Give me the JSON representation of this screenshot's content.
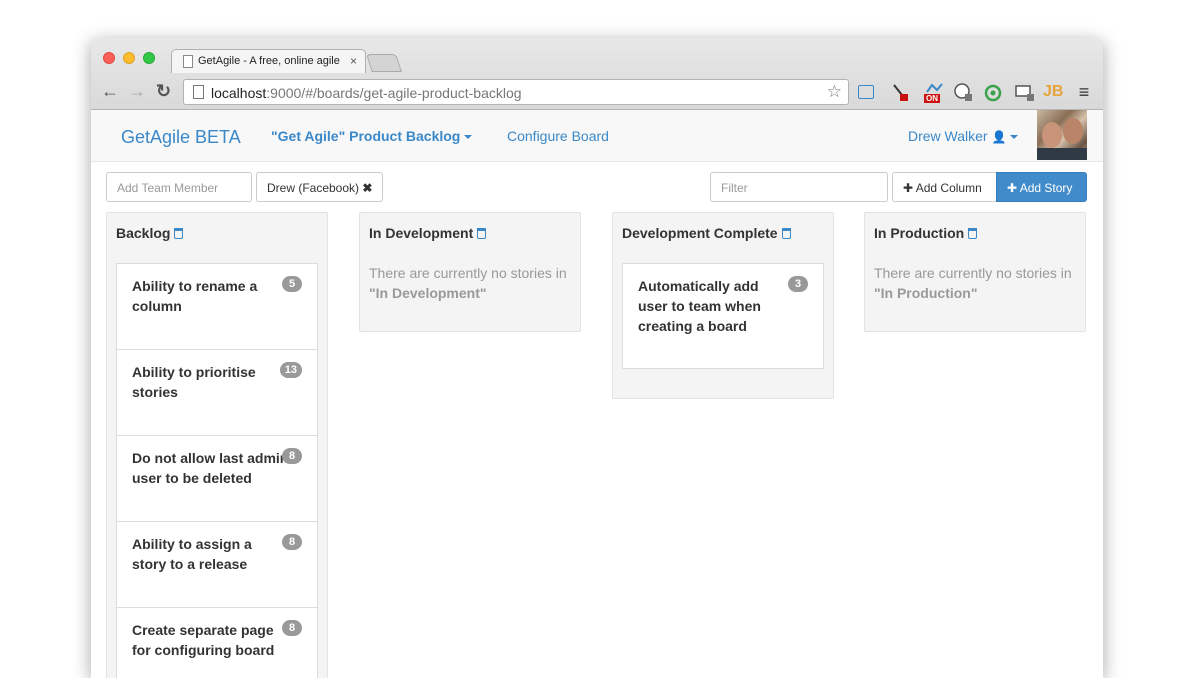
{
  "browser": {
    "tab_title": "GetAgile - A free, online agile",
    "tab_close": "×",
    "url_host": "localhost",
    "url_path": ":9000/#/boards/get-agile-product-backlog",
    "back_icon": "←",
    "forward_icon": "→",
    "reload_icon": "↻",
    "star_icon": "☆",
    "menu_icon": "≡",
    "ext_badge_on": "ON",
    "ext_jb": "JB"
  },
  "nav": {
    "brand": "GetAgile BETA",
    "board_name": "\"Get Agile\" Product Backlog",
    "configure": "Configure Board",
    "user_name": "Drew Walker",
    "user_icon": "👤"
  },
  "toolbar": {
    "add_member_placeholder": "Add Team Member",
    "member_chip": "Drew (Facebook)",
    "chip_remove": "✖",
    "filter_placeholder": "Filter",
    "add_column": "Add Column",
    "add_story": "Add Story",
    "plus": "✚"
  },
  "columns": [
    {
      "title": "Backlog",
      "stories": [
        {
          "title": "Ability to rename a column",
          "points": "5"
        },
        {
          "title": "Ability to prioritise stories",
          "points": "13"
        },
        {
          "title": "Do not allow last admin user to be deleted",
          "points": "8"
        },
        {
          "title": "Ability to assign a story to a release",
          "points": "8"
        },
        {
          "title": "Create separate page for configuring board",
          "points": "8"
        }
      ]
    },
    {
      "title": "In Development",
      "empty_prefix": "There are currently no stories in",
      "empty_name": "\"In Development\""
    },
    {
      "title": "Development Complete",
      "stories": [
        {
          "title": "Automatically add user to team when creating a board",
          "points": "3"
        }
      ]
    },
    {
      "title": "In Production",
      "empty_prefix": "There are currently no stories in",
      "empty_name": "\"In Production\""
    }
  ]
}
